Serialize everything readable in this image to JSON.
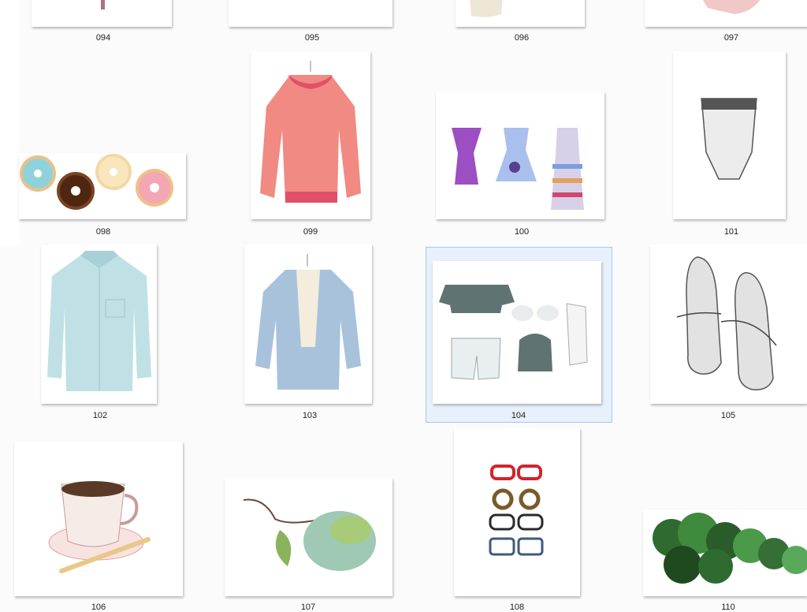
{
  "grid": {
    "selected_index": 10,
    "items": [
      {
        "label": "094",
        "icon": "dress-hem-thumbnail-icon"
      },
      {
        "label": "095",
        "icon": "blank-thumbnail-icon"
      },
      {
        "label": "096",
        "icon": "lace-garment-thumbnail-icon"
      },
      {
        "label": "097",
        "icon": "pink-garment-thumbnail-icon"
      },
      {
        "label": "098",
        "icon": "donuts-thumbnail-icon"
      },
      {
        "label": "099",
        "icon": "pink-sweater-thumbnail-icon"
      },
      {
        "label": "100",
        "icon": "three-dresses-thumbnail-icon"
      },
      {
        "label": "101",
        "icon": "corset-thumbnail-icon"
      },
      {
        "label": "102",
        "icon": "denim-shirt-thumbnail-icon"
      },
      {
        "label": "103",
        "icon": "denim-jacket-thumbnail-icon"
      },
      {
        "label": "104",
        "icon": "outfit-set-thumbnail-icon"
      },
      {
        "label": "105",
        "icon": "sneakers-thumbnail-icon"
      },
      {
        "label": "106",
        "icon": "coffee-cup-thumbnail-icon"
      },
      {
        "label": "107",
        "icon": "leaf-branch-thumbnail-icon"
      },
      {
        "label": "108",
        "icon": "eyeglasses-thumbnail-icon"
      },
      {
        "label": "110",
        "icon": "trees-thumbnail-icon"
      }
    ]
  }
}
